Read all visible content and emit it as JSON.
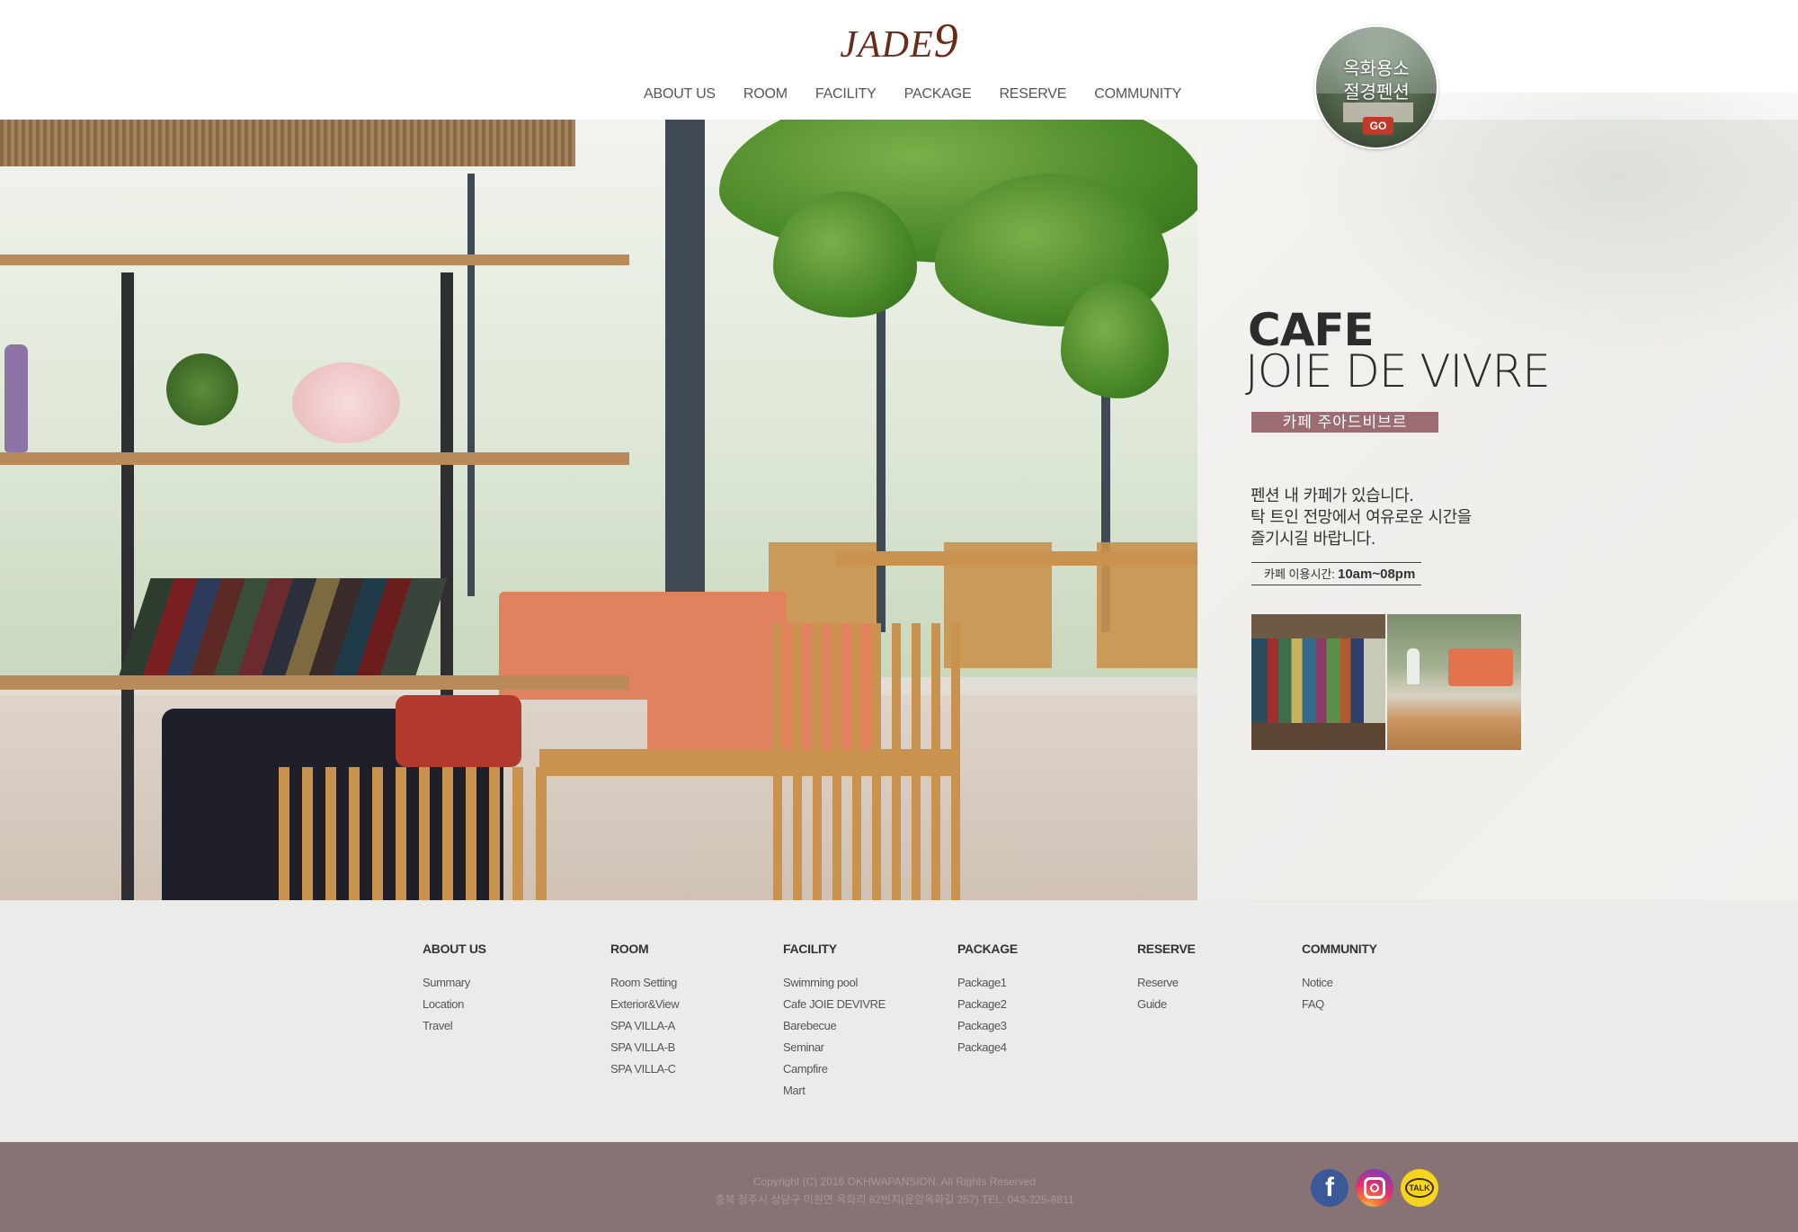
{
  "brand": {
    "logo_text": "JADE",
    "logo_number": "9",
    "brand_color": "#6a2c1a"
  },
  "nav": {
    "items": [
      {
        "label": "ABOUT US"
      },
      {
        "label": "ROOM"
      },
      {
        "label": "FACILITY"
      },
      {
        "label": "PACKAGE"
      },
      {
        "label": "RESERVE"
      },
      {
        "label": "COMMUNITY"
      }
    ]
  },
  "promo": {
    "line1": "옥화용소",
    "line2": "절경펜션",
    "go_label": "GO"
  },
  "hero": {
    "title": "CAFE",
    "subtitle": "JOIE DE VIVRE",
    "badge": "카페 주아드비브르",
    "badge_color": "#9b6d72",
    "description": [
      "펜션 내 카페가 있습니다.",
      "탁 트인 전망에서 여유로운 시간을",
      "즐기시길 바랍니다."
    ],
    "hours_label": "카페 이용시간:",
    "hours_value": "10am~08pm"
  },
  "footer_nav": {
    "columns": [
      {
        "title": "ABOUT US",
        "links": [
          "Summary",
          "Location",
          "Travel"
        ]
      },
      {
        "title": "ROOM",
        "links": [
          "Room Setting",
          "Exterior&View",
          "SPA VILLA-A",
          "SPA VILLA-B",
          "SPA VILLA-C"
        ]
      },
      {
        "title": "FACILITY",
        "links": [
          "Swimming pool",
          "Cafe JOIE DEVIVRE",
          "Barebecue",
          "Seminar",
          "Campfire",
          "Mart"
        ]
      },
      {
        "title": "PACKAGE",
        "links": [
          "Package1",
          "Package2",
          "Package3",
          "Package4"
        ]
      },
      {
        "title": "RESERVE",
        "links": [
          "Reserve",
          "Guide"
        ]
      },
      {
        "title": "COMMUNITY",
        "links": [
          "Notice",
          "FAQ"
        ]
      }
    ]
  },
  "bottom": {
    "copyright": "Copyright (C) 2016 OKHWAPANSION. All Rights Reserved",
    "address": "충북 청주시 상당구 미원면 옥화리 82번지(운암옥화길 257) TEL: 043-225-8811",
    "bar_color": "#877373",
    "social": [
      {
        "icon": "facebook-icon",
        "glyph": "f"
      },
      {
        "icon": "instagram-icon"
      },
      {
        "icon": "kakaotalk-icon",
        "glyph": "TALK"
      }
    ]
  }
}
